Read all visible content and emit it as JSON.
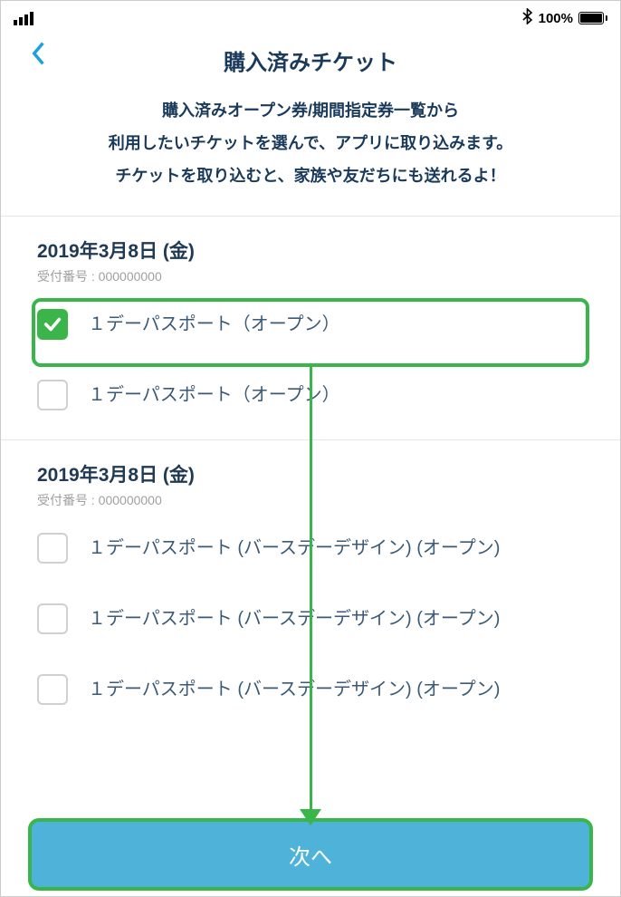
{
  "status": {
    "battery_pct": "100%",
    "bluetooth_glyph": "✱"
  },
  "header": {
    "title": "購入済みチケット"
  },
  "intro": {
    "line1": "購入済みオープン券/期間指定券一覧から",
    "line2": "利用したいチケットを選んで、アプリに取り込みます。",
    "line3": "チケットを取り込むと、家族や友だちにも送れるよ！"
  },
  "ref_label": "受付番号 :",
  "groups": [
    {
      "date": "2019年3月8日 (金)",
      "ref": "000000000",
      "tickets": [
        {
          "label": "１デーパスポート（オープン）",
          "checked": true
        },
        {
          "label": "１デーパスポート（オープン）",
          "checked": false
        }
      ]
    },
    {
      "date": "2019年3月8日 (金)",
      "ref": "000000000",
      "tickets": [
        {
          "label": "１デーパスポート (バースデーデザイン) (オープン)",
          "checked": false
        },
        {
          "label": "１デーパスポート (バースデーデザイン) (オープン)",
          "checked": false
        },
        {
          "label": "１デーパスポート (バースデーデザイン) (オープン)",
          "checked": false
        }
      ]
    }
  ],
  "footer": {
    "next_label": "次へ"
  }
}
